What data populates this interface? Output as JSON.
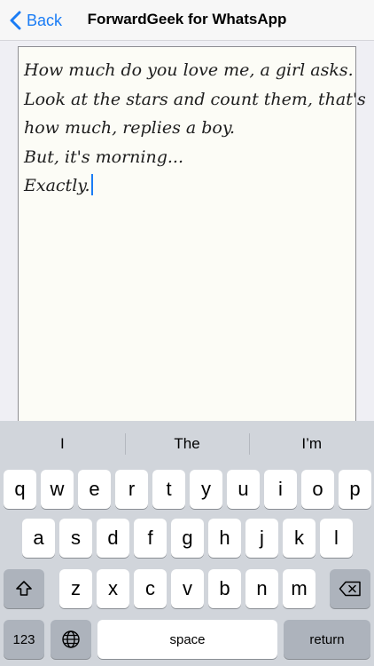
{
  "nav": {
    "back_label": "Back",
    "title": "ForwardGeek for WhatsApp"
  },
  "editor": {
    "lines": [
      "How much do you love me, a girl asks.",
      "Look at the stars and count them, that's",
      "how much, replies a boy.",
      "But, it's morning...",
      "Exactly."
    ]
  },
  "keyboard": {
    "suggestions": [
      "I",
      "The",
      "I’m"
    ],
    "row1": [
      "q",
      "w",
      "e",
      "r",
      "t",
      "y",
      "u",
      "i",
      "o",
      "p"
    ],
    "row2": [
      "a",
      "s",
      "d",
      "f",
      "g",
      "h",
      "j",
      "k",
      "l"
    ],
    "row3": [
      "z",
      "x",
      "c",
      "v",
      "b",
      "n",
      "m"
    ],
    "numbers_label": "123",
    "space_label": "space",
    "return_label": "return"
  },
  "colors": {
    "accent": "#1a7cf5",
    "keyboard_bg": "#d1d5db",
    "editor_bg": "#fcfcf6"
  },
  "icons": {
    "back": "chevron-left-icon",
    "shift": "shift-icon",
    "delete": "backspace-icon",
    "globe": "globe-icon"
  }
}
